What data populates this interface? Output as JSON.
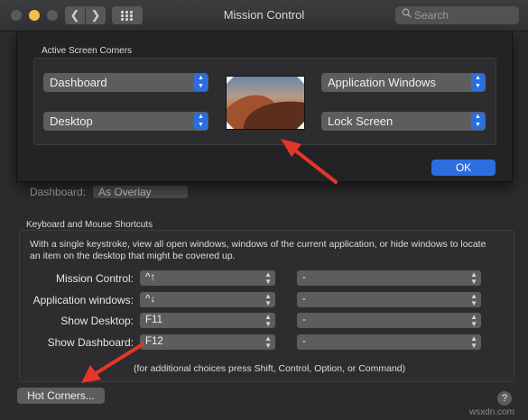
{
  "window": {
    "title": "Mission Control"
  },
  "toolbar": {
    "back_glyph": "❮",
    "forward_glyph": "❯",
    "search_placeholder": "Search",
    "search_icon": "search-icon"
  },
  "hot_corners_sheet": {
    "group_label": "Active Screen Corners",
    "top_left": "Dashboard",
    "top_right": "Application Windows",
    "bottom_left": "Desktop",
    "bottom_right": "Lock Screen",
    "ok_label": "OK"
  },
  "dashboard_behind": {
    "label": "Dashboard:",
    "value": "As Overlay"
  },
  "shortcuts": {
    "group_label": "Keyboard and Mouse Shortcuts",
    "description": "With a single keystroke, view all open windows, windows of the current application, or hide windows to locate an item on the desktop that might be covered up.",
    "rows": [
      {
        "label": "Mission Control:",
        "key": "^↑",
        "mouse": "-"
      },
      {
        "label": "Application windows:",
        "key": "^↓",
        "mouse": "-"
      },
      {
        "label": "Show Desktop:",
        "key": "F11",
        "mouse": "-"
      },
      {
        "label": "Show Dashboard:",
        "key": "F12",
        "mouse": "-"
      }
    ],
    "note": "(for additional choices press Shift, Control, Option, or Command)"
  },
  "footer": {
    "hot_corners_label": "Hot Corners...",
    "help_label": "?"
  },
  "watermark": "wsxdn.com",
  "colors": {
    "accent": "#2c6ee0",
    "arrow": "#e8352a"
  }
}
